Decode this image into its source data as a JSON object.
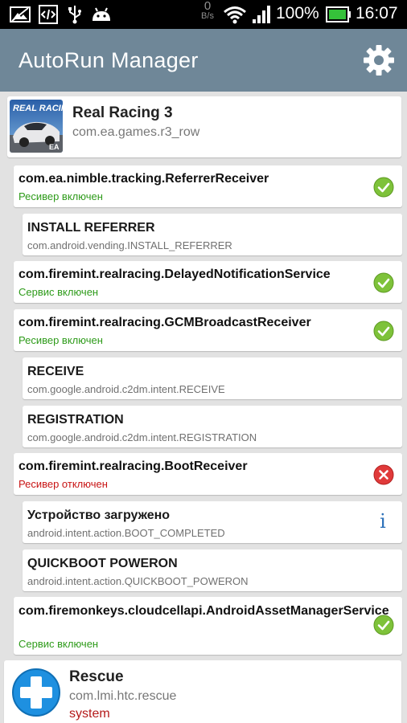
{
  "status_bar": {
    "net_speed_value": "0",
    "net_speed_unit": "B/s",
    "battery_text": "100%",
    "time": "16:07",
    "icons": [
      "image-notification-icon",
      "code-notification-icon",
      "usb-icon",
      "android-icon",
      "wifi-icon",
      "signal-icon",
      "battery-icon"
    ]
  },
  "app_bar": {
    "title": "AutoRun Manager",
    "settings_icon": "gear-icon"
  },
  "apps": [
    {
      "name": "Real Racing 3",
      "package": "com.ea.games.r3_row",
      "icon_text": "REAL RACING",
      "icon_badge": "EA",
      "components": [
        {
          "name": "com.ea.nimble.tracking.ReferrerReceiver",
          "status": "Ресивер включен",
          "enabled": true,
          "intents": [
            {
              "name": "INSTALL REFERRER",
              "action": "com.android.vending.INSTALL_REFERRER"
            }
          ]
        },
        {
          "name": "com.firemint.realracing.DelayedNotificationService",
          "status": "Сервис включен",
          "enabled": true,
          "intents": []
        },
        {
          "name": "com.firemint.realracing.GCMBroadcastReceiver",
          "status": "Ресивер включен",
          "enabled": true,
          "intents": [
            {
              "name": "RECEIVE",
              "action": "com.google.android.c2dm.intent.RECEIVE"
            },
            {
              "name": "REGISTRATION",
              "action": "com.google.android.c2dm.intent.REGISTRATION"
            }
          ]
        },
        {
          "name": "com.firemint.realracing.BootReceiver",
          "status": "Ресивер отключен",
          "enabled": false,
          "intents": [
            {
              "name": "Устройство загружено",
              "action": "android.intent.action.BOOT_COMPLETED",
              "info_icon": "i"
            },
            {
              "name": "QUICKBOOT POWERON",
              "action": "android.intent.action.QUICKBOOT_POWERON"
            }
          ]
        },
        {
          "name": "com.firemonkeys.cloudcellapi.AndroidAssetManagerService",
          "status": "Сервис включен",
          "enabled": true,
          "intents": []
        }
      ]
    },
    {
      "name": "Rescue",
      "package": "com.lmi.htc.rescue",
      "system_label": "system"
    }
  ],
  "colors": {
    "app_bar": "#6f8798",
    "background": "#e2e2e2",
    "enabled_text": "#2e9b1a",
    "disabled_text": "#c81414",
    "enabled_icon": "#7ec23a",
    "disabled_icon": "#e03a3a",
    "info_icon": "#2a6fb8",
    "rescue_icon": "#1e90e0"
  }
}
